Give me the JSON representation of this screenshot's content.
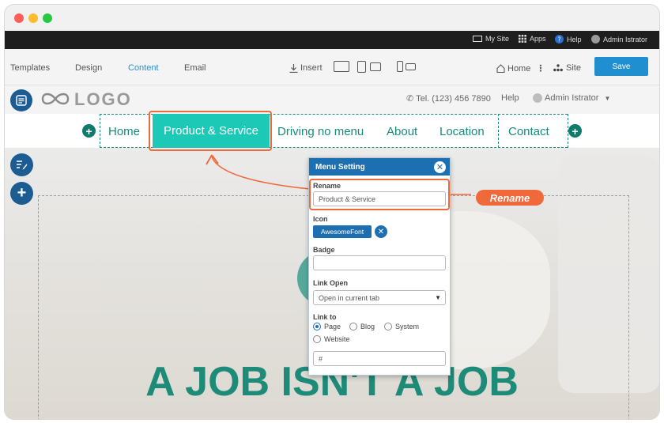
{
  "adminbar": {
    "my_site": "My Site",
    "apps": "Apps",
    "help": "Help",
    "user": "Admin Istrator"
  },
  "toolbar": {
    "tabs": [
      "Templates",
      "Design",
      "Content",
      "Email"
    ],
    "active_tab": "Content",
    "insert": "Insert",
    "home": "Home",
    "site": "Site",
    "save": "Save"
  },
  "site": {
    "logo": "LOGO",
    "phone": "Tel. (123) 456 7890",
    "help": "Help",
    "user": "Admin Istrator",
    "nav": [
      "Home",
      "Product & Service",
      "Driving no menu",
      "About",
      "Location",
      "Contact"
    ],
    "active_nav": "Product & Service",
    "headline": "A JOB ISN'T A JOB"
  },
  "dialog": {
    "title": "Menu Setting",
    "rename_label": "Rename",
    "rename_value": "Product & Service",
    "icon_label": "Icon",
    "icon_button": "AwesomeFont",
    "badge_label": "Badge",
    "badge_value": "",
    "link_open_label": "Link Open",
    "link_open_value": "Open in current tab",
    "link_to_label": "Link to",
    "link_options": [
      "Page",
      "Blog",
      "System",
      "Website"
    ],
    "selected_link": "Page",
    "link_value": "#"
  },
  "annotation": {
    "label": "Rename",
    "color": "#f0693a"
  },
  "colors": {
    "accent": "#1cc9b6",
    "primary": "#1c6fb1",
    "nav_text": "#178a7a",
    "annotation": "#f0693a"
  }
}
